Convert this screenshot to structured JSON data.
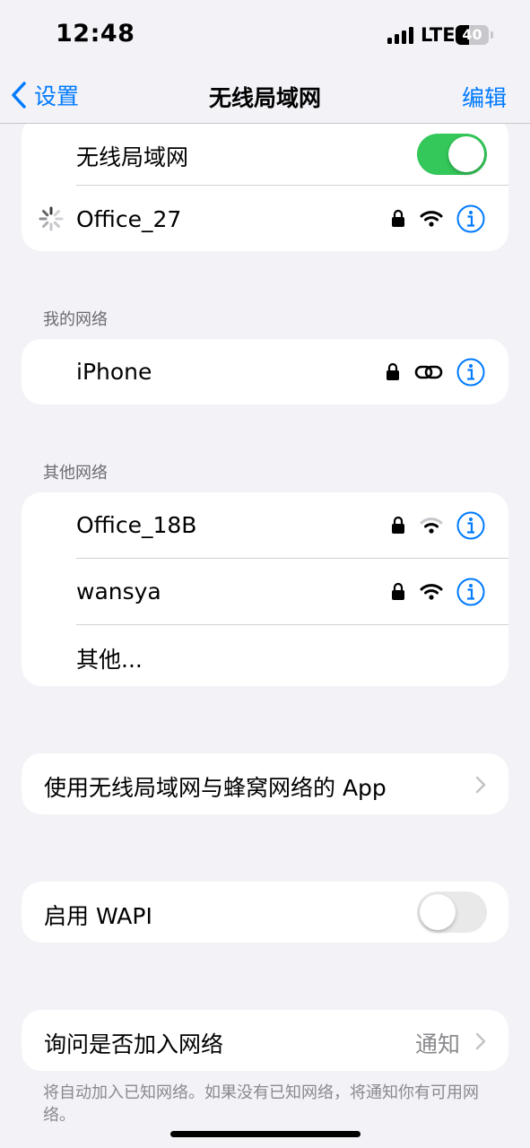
{
  "status_bar": {
    "time": "12:48",
    "network": "LTE",
    "battery": "40",
    "battery_level": 0.4
  },
  "nav": {
    "back_label": "设置",
    "title": "无线局域网",
    "edit_label": "编辑"
  },
  "wifi_group": {
    "toggle_label": "无线局域网",
    "toggle_on": true,
    "connected_network": "Office_27"
  },
  "my_networks": {
    "header": "我的网络",
    "items": [
      {
        "name": "iPhone"
      }
    ]
  },
  "other_networks": {
    "header": "其他网络",
    "items": [
      {
        "name": "Office_18B"
      },
      {
        "name": "wansya"
      }
    ],
    "other_label": "其他..."
  },
  "apps_row": {
    "label": "使用无线局域网与蜂窝网络的 App"
  },
  "wapi_row": {
    "label": "启用 WAPI",
    "toggle_on": false
  },
  "ask_join": {
    "label": "询问是否加入网络",
    "value": "通知",
    "footer": "将自动加入已知网络。如果没有已知网络，将通知你有可用网络。"
  },
  "colors": {
    "accent": "#007aff",
    "toggle_on": "#34c759",
    "toggle_off": "#e9e9ea",
    "background": "#f2f2f7"
  }
}
